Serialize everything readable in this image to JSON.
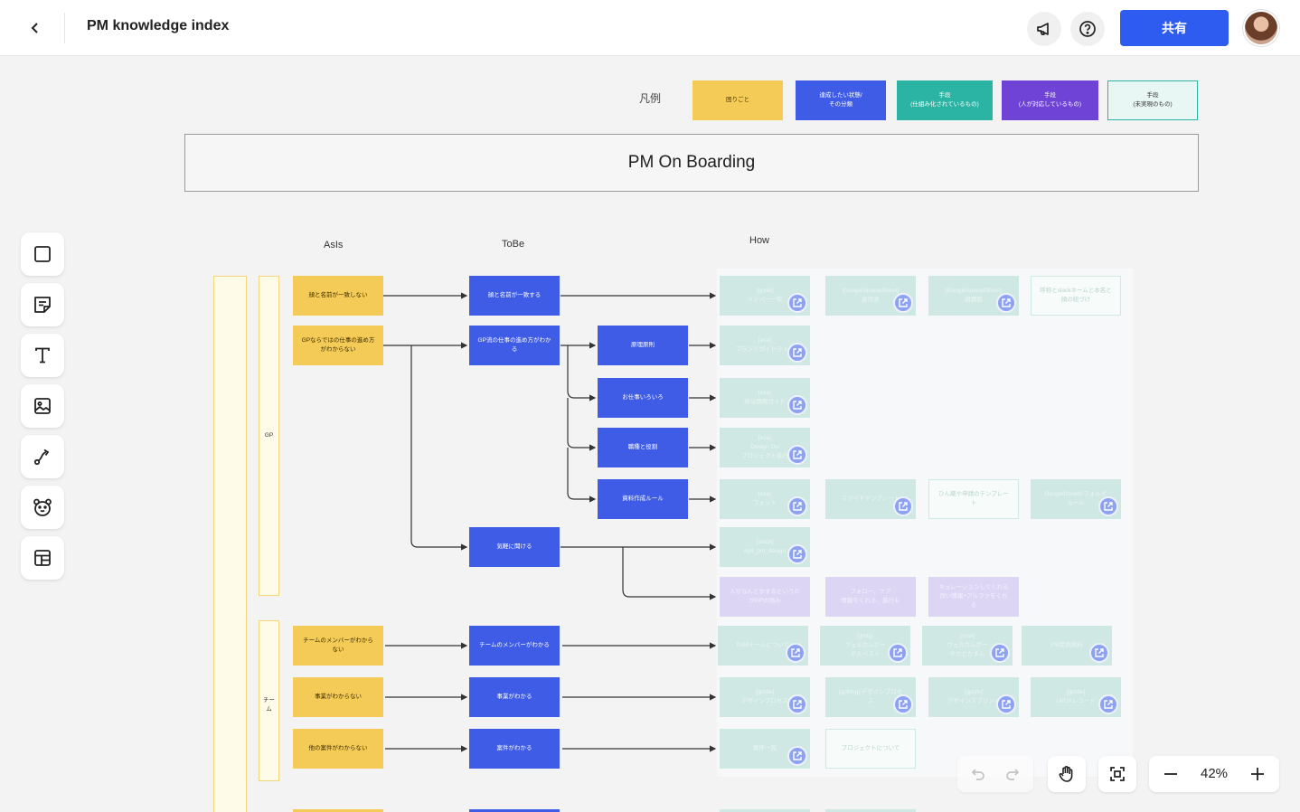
{
  "header": {
    "title": "PM knowledge index",
    "share_label": "共有"
  },
  "legend": {
    "label": "凡例",
    "items": [
      {
        "text": "困りごと",
        "color": "#f5cb58"
      },
      {
        "text": "達成したい状態/\nその分類",
        "color": "#3e5ce5"
      },
      {
        "text": "手段\n(仕組み化されているもの)",
        "color": "#2bb3a3"
      },
      {
        "text": "手段\n(人が対応しているもの)",
        "color": "#6f43d6"
      },
      {
        "text": "手段\n(未実現のもの)",
        "color": "#e8f7f4"
      }
    ]
  },
  "board": {
    "title": "PM On Boarding"
  },
  "columns": {
    "asis": "AsIs",
    "tobe": "ToBe",
    "how": "How"
  },
  "groups": {
    "gp": "GP",
    "team": "チー\nム"
  },
  "asis": {
    "a1": "顔と名前が一致しない",
    "a2": "GPならではの仕事の進め方\nがわからない",
    "a3": "チームのメンバーがわから\nない",
    "a4": "事業がわからない",
    "a5": "他の案件がわからない"
  },
  "tobe": {
    "b1": "顔と名前が一致する",
    "b2": "GP流の仕事の進め方がわか\nる",
    "b3": "気軽に聞ける",
    "b4": "チームのメンバーがわかる",
    "b5": "事業がわかる",
    "b6": "案件がわかる"
  },
  "sub": {
    "s1": "原理原則",
    "s2": "お仕事いろいろ",
    "s3": "職種と役割",
    "s4": "資料作成ルール"
  },
  "how": {
    "h1": "[gpde]\nメンバー一覧",
    "h2": "[GoogleSpreadSheet]\n座席表",
    "h3": "[GoogleSpreadSheet]\n組織図",
    "h4": "呼称とslackネームと本名と\n顔の紐づけ",
    "h5": "[esa]\nブランドガイドライン",
    "h6": "[esa]\n新公開用ガイド",
    "h7": "[esa]\nDesign Div\nプロジェクト進行",
    "h8": "[esa]\nフォント",
    "h9": "スライドテンプレート",
    "h10": "ひん蔵や申請のテンプレー\nト",
    "h11": "GoogleDriveのフォルダ\nルール",
    "h12": "[slack]\n#pd_pm_design",
    "h13": "人がなんとかするというの\nがGPの強み",
    "h14": "フォロー、ケア\n情報をくれる、進行も",
    "h15": "キュレーションしてくれる\n良い情報+アルファをくれ\nる",
    "h16": "PdMチームについて",
    "h17": "[gmtg]\nウェルカムボー\nドルペスト",
    "h18": "[mail]\nウェルカムボー\nドカとかまん",
    "h19": "PM定例資料",
    "h20": "[gpsite]\nデザインプロセス",
    "h21": "[gpblog] デザインプロセ\nス",
    "h22": "[gpsite]\nデザインスプリント",
    "h23": "[gpsite]\nUI/UXレコード",
    "h24": "案件一覧",
    "h25": "プロジェクトについて"
  },
  "zoom": {
    "value": "42%"
  }
}
